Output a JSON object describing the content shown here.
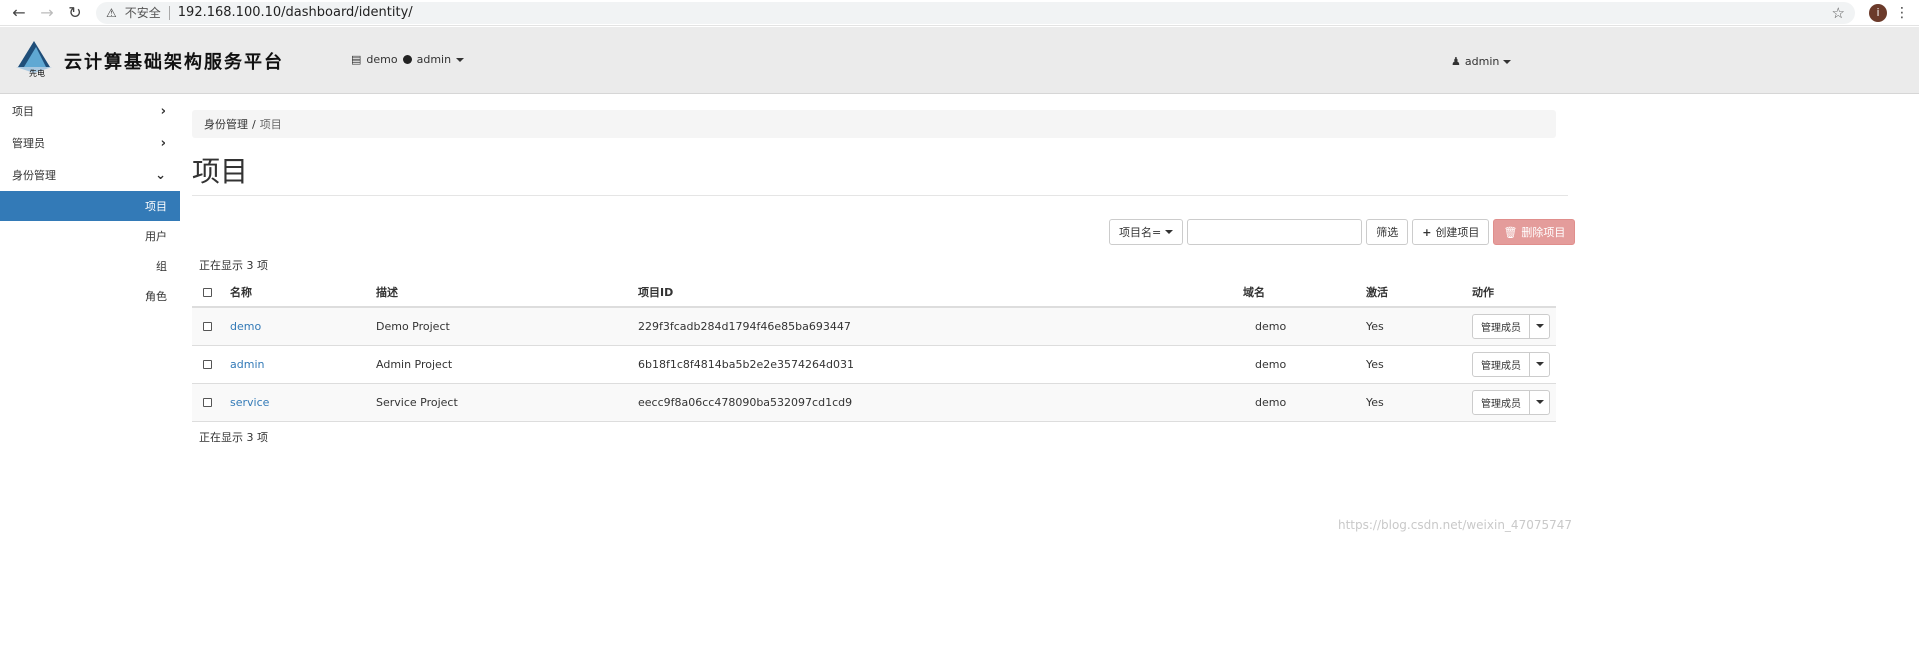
{
  "browser": {
    "insecure_label": "不安全",
    "url": "192.168.100.10/dashboard/identity/",
    "profile_initial": "i"
  },
  "header": {
    "brand": "云计算基础架构服务平台",
    "logo_text": "先电",
    "project_name": "demo",
    "project_user": "admin",
    "user_menu": "admin"
  },
  "sidebar": {
    "categories": [
      {
        "label": "项目",
        "expanded": false
      },
      {
        "label": "管理员",
        "expanded": false
      },
      {
        "label": "身份管理",
        "expanded": true
      }
    ],
    "sub_items": [
      {
        "label": "项目",
        "active": true
      },
      {
        "label": "用户",
        "active": false
      },
      {
        "label": "组",
        "active": false
      },
      {
        "label": "角色",
        "active": false
      }
    ]
  },
  "breadcrumb": {
    "parent": "身份管理",
    "separator": "/",
    "current": "项目"
  },
  "page_title": "项目",
  "toolbar": {
    "filter_field": "项目名=",
    "filter_value": "",
    "filter_button": "筛选",
    "create_button": "创建项目",
    "delete_button": "删除项目"
  },
  "count_text_top": "正在显示 3 项",
  "count_text_bottom": "正在显示 3 项",
  "table": {
    "columns": [
      "名称",
      "描述",
      "项目ID",
      "域名",
      "激活",
      "动作"
    ],
    "rows": [
      {
        "name": "demo",
        "description": "Demo Project",
        "id": "229f3fcadb284d1794f46e85ba693447",
        "domain": "demo",
        "enabled": "Yes",
        "action": "管理成员"
      },
      {
        "name": "admin",
        "description": "Admin Project",
        "id": "6b18f1c8f4814ba5b2e2e3574264d031",
        "domain": "demo",
        "enabled": "Yes",
        "action": "管理成员"
      },
      {
        "name": "service",
        "description": "Service Project",
        "id": "eecc9f8a06cc478090ba532097cd1cd9",
        "domain": "demo",
        "enabled": "Yes",
        "action": "管理成员"
      }
    ]
  },
  "watermark": "https://blog.csdn.net/weixin_47075747",
  "colors": {
    "accent": "#337ab7",
    "danger": "#e49c9b",
    "header_bg": "#ebebeb"
  }
}
